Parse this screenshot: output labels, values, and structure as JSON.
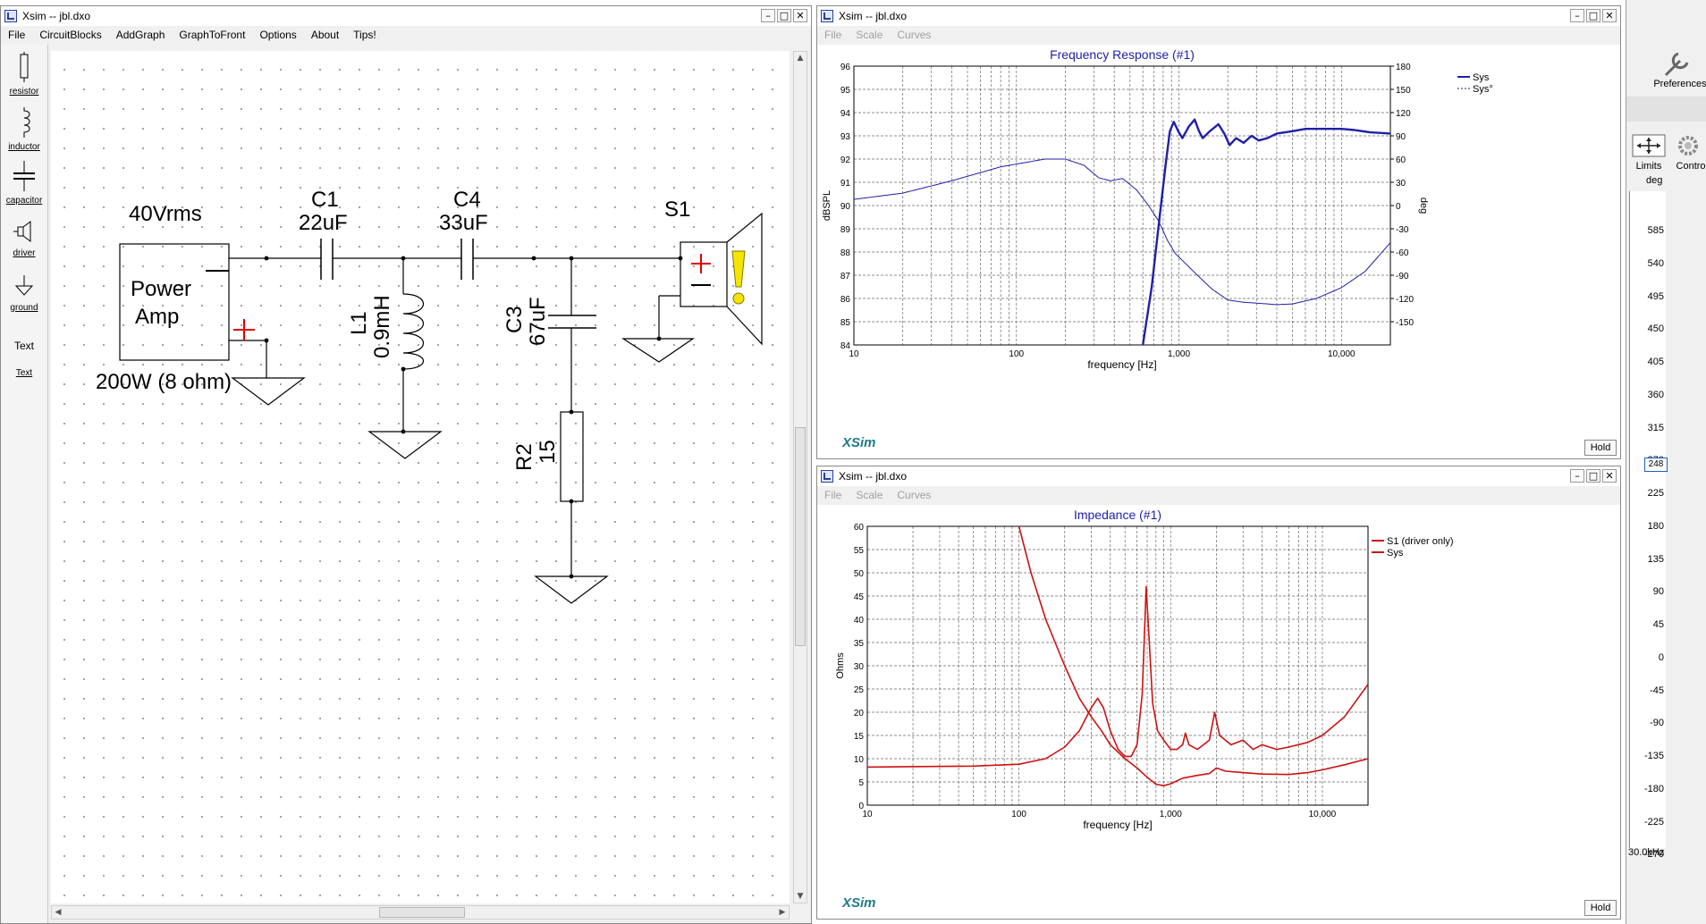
{
  "schematic_window": {
    "title": "Xsim -- jbl.dxo",
    "menu": [
      "File",
      "CircuitBlocks",
      "AddGraph",
      "GraphToFront",
      "Options",
      "About",
      "Tips!"
    ],
    "tools": [
      "resistor",
      "inductor",
      "capacitor",
      "driver",
      "ground",
      "Text",
      "Text"
    ],
    "labels": {
      "source_voltage": "40Vrms",
      "power_amp_line1": "Power",
      "power_amp_line2": "Amp",
      "power_rating": "200W (8 ohm)",
      "c1_name": "C1",
      "c1_value": "22uF",
      "c4_name": "C4",
      "c4_value": "33uF",
      "l1_name": "L1",
      "l1_value": "0.9mH",
      "c3_name": "C3",
      "c3_value": "67uF",
      "r2_name": "R2",
      "r2_value": "15",
      "s1_name": "S1"
    }
  },
  "freq_window": {
    "title": "Xsim -- jbl.dxo",
    "menu": [
      "File",
      "Scale",
      "Curves"
    ],
    "logo": "XSim",
    "hold_label": "Hold"
  },
  "imp_window": {
    "title": "Xsim -- jbl.dxo",
    "menu": [
      "File",
      "Scale",
      "Curves"
    ],
    "logo": "XSim",
    "hold_label": "Hold"
  },
  "right_panel": {
    "preferences_label": "Preferences",
    "limits_label": "Limits",
    "controls_label": "Controls",
    "unit_label": "deg",
    "scale_ticks": [
      "585",
      "540",
      "495",
      "450",
      "405",
      "360",
      "315",
      "270",
      "225",
      "180",
      "135",
      "90",
      "45",
      "0",
      "-45",
      "-90",
      "-135",
      "-180",
      "-225",
      "-270"
    ],
    "marker_value": "248",
    "bottom_label": "30.0kHz"
  },
  "chart_data": [
    {
      "type": "line",
      "title": "Frequency Response (#1)",
      "xlabel": "frequency [Hz]",
      "ylabel": "dBSPL",
      "y2label": "deg",
      "xscale": "log",
      "xlim": [
        10,
        20000
      ],
      "ylim": [
        84,
        96
      ],
      "y2lim": [
        -180,
        180
      ],
      "x_ticks": [
        "10",
        "100",
        "1,000",
        "10,000"
      ],
      "y_ticks": [
        "84",
        "85",
        "86",
        "87",
        "88",
        "89",
        "90",
        "91",
        "92",
        "93",
        "94",
        "95",
        "96"
      ],
      "y2_ticks": [
        "-150",
        "-120",
        "-90",
        "-60",
        "-30",
        "0",
        "30",
        "60",
        "90",
        "120",
        "150",
        "180"
      ],
      "grid": true,
      "legend_position": "top-right",
      "series": [
        {
          "name": "Sys",
          "style": "solid",
          "width": 2.4,
          "color": "#1f1fa8",
          "axis": "left",
          "points": [
            [
              600,
              84.0
            ],
            [
              680,
              86.5
            ],
            [
              760,
              89.5
            ],
            [
              830,
              91.8
            ],
            [
              880,
              93.2
            ],
            [
              930,
              93.6
            ],
            [
              990,
              93.2
            ],
            [
              1050,
              92.9
            ],
            [
              1150,
              93.4
            ],
            [
              1250,
              93.7
            ],
            [
              1330,
              93.2
            ],
            [
              1400,
              92.9
            ],
            [
              1550,
              93.2
            ],
            [
              1750,
              93.5
            ],
            [
              1900,
              93.1
            ],
            [
              2050,
              92.6
            ],
            [
              2250,
              92.9
            ],
            [
              2500,
              92.7
            ],
            [
              2800,
              93.0
            ],
            [
              3100,
              92.8
            ],
            [
              3500,
              92.9
            ],
            [
              4000,
              93.1
            ],
            [
              5000,
              93.2
            ],
            [
              6000,
              93.3
            ],
            [
              8000,
              93.3
            ],
            [
              10000,
              93.3
            ],
            [
              12000,
              93.25
            ],
            [
              15000,
              93.15
            ],
            [
              20000,
              93.1
            ]
          ]
        },
        {
          "name": "Sys°",
          "style": "dashed",
          "width": 1,
          "color": "#1f1fa8",
          "axis": "right",
          "points": [
            [
              10,
              8
            ],
            [
              20,
              16
            ],
            [
              40,
              32
            ],
            [
              80,
              50
            ],
            [
              150,
              60
            ],
            [
              200,
              60
            ],
            [
              260,
              52
            ],
            [
              320,
              36
            ],
            [
              380,
              32
            ],
            [
              450,
              35
            ],
            [
              550,
              20
            ],
            [
              650,
              0
            ],
            [
              750,
              -20
            ],
            [
              850,
              -45
            ],
            [
              950,
              -62
            ],
            [
              1100,
              -75
            ],
            [
              1300,
              -90
            ],
            [
              1600,
              -108
            ],
            [
              2000,
              -122
            ],
            [
              2500,
              -125
            ],
            [
              3000,
              -126
            ],
            [
              4000,
              -128
            ],
            [
              5000,
              -127
            ],
            [
              7000,
              -120
            ],
            [
              10000,
              -106
            ],
            [
              14000,
              -85
            ],
            [
              20000,
              -48
            ]
          ]
        }
      ]
    },
    {
      "type": "line",
      "title": "Impedance (#1)",
      "xlabel": "frequency [Hz]",
      "ylabel": "Ohms",
      "xscale": "log",
      "xlim": [
        10,
        20000
      ],
      "ylim": [
        0,
        60
      ],
      "x_ticks": [
        "10",
        "100",
        "1,000",
        "10,000"
      ],
      "y_ticks": [
        "0",
        "5",
        "10",
        "15",
        "20",
        "25",
        "30",
        "35",
        "40",
        "45",
        "50",
        "55",
        "60"
      ],
      "grid": true,
      "legend_position": "top-right",
      "series": [
        {
          "name": "S1 (driver only)",
          "color": "#cc1111",
          "points": [
            [
              10,
              8.2
            ],
            [
              50,
              8.4
            ],
            [
              100,
              8.8
            ],
            [
              150,
              10
            ],
            [
              200,
              12.5
            ],
            [
              250,
              16
            ],
            [
              300,
              21
            ],
            [
              330,
              23
            ],
            [
              360,
              21
            ],
            [
              400,
              16
            ],
            [
              450,
              12
            ],
            [
              500,
              10.5
            ],
            [
              550,
              10.5
            ],
            [
              600,
              13
            ],
            [
              650,
              24
            ],
            [
              690,
              47
            ],
            [
              720,
              36
            ],
            [
              760,
              22
            ],
            [
              820,
              16
            ],
            [
              900,
              14
            ],
            [
              1000,
              12
            ],
            [
              1100,
              12
            ],
            [
              1200,
              13
            ],
            [
              1250,
              15.5
            ],
            [
              1320,
              13
            ],
            [
              1500,
              12
            ],
            [
              1800,
              14
            ],
            [
              1950,
              20
            ],
            [
              2100,
              15
            ],
            [
              2500,
              13
            ],
            [
              3000,
              14
            ],
            [
              3500,
              12
            ],
            [
              4000,
              13
            ],
            [
              5000,
              12
            ],
            [
              6000,
              12.5
            ],
            [
              8000,
              13.5
            ],
            [
              10000,
              15
            ],
            [
              14000,
              19
            ],
            [
              20000,
              26
            ]
          ]
        },
        {
          "name": "Sys",
          "color": "#cc1111",
          "points": [
            [
              100,
              60
            ],
            [
              120,
              50
            ],
            [
              150,
              40
            ],
            [
              200,
              30
            ],
            [
              250,
              23
            ],
            [
              300,
              19
            ],
            [
              350,
              16
            ],
            [
              400,
              13
            ],
            [
              500,
              10
            ],
            [
              600,
              8
            ],
            [
              700,
              6
            ],
            [
              800,
              4.5
            ],
            [
              900,
              4.2
            ],
            [
              1000,
              4.6
            ],
            [
              1200,
              5.8
            ],
            [
              1500,
              6.4
            ],
            [
              1800,
              6.8
            ],
            [
              2000,
              8
            ],
            [
              2300,
              7.3
            ],
            [
              3000,
              7
            ],
            [
              4000,
              6.7
            ],
            [
              6000,
              6.6
            ],
            [
              8000,
              7
            ],
            [
              10000,
              7.6
            ],
            [
              14000,
              8.7
            ],
            [
              20000,
              10
            ]
          ]
        }
      ]
    }
  ]
}
